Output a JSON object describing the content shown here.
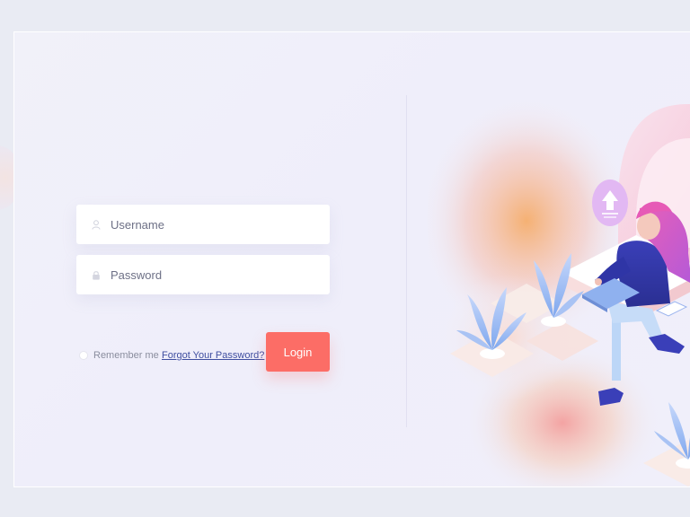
{
  "login_form": {
    "username": {
      "value": "",
      "placeholder": "Username",
      "icon": "user-icon"
    },
    "password": {
      "value": "",
      "placeholder": "Password",
      "icon": "lock-icon"
    },
    "remember_label": "Remember me",
    "remember_checked": false,
    "forgot_label": "Forgot Your Password?",
    "login_label": "Login"
  },
  "colors": {
    "accent": "#fc6d66",
    "link": "#3f4ea0",
    "background": "#e9ebf3",
    "card": "#f0effa"
  }
}
